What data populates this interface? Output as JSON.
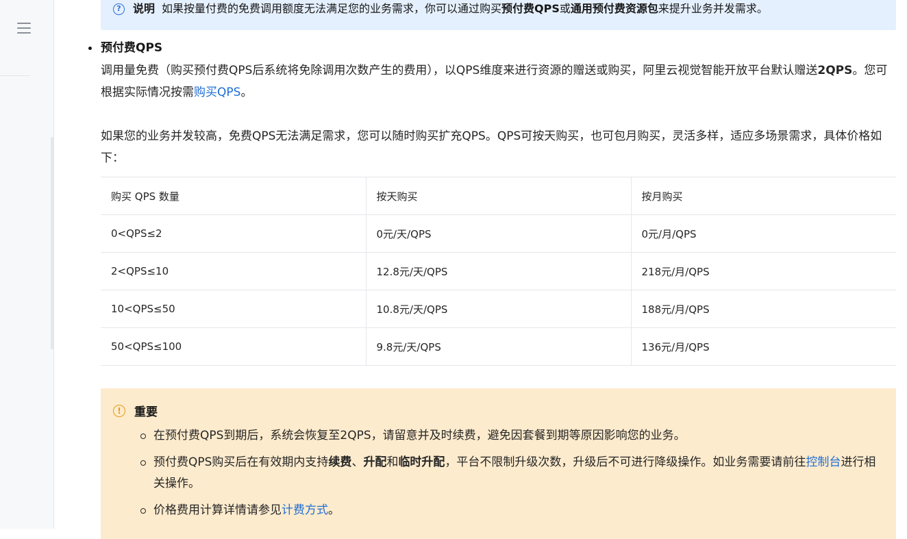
{
  "note": {
    "label": "说明",
    "text_a": "如果按量付费的免费调用额度无法满足您的业务需求，你可以通过购买",
    "bold_a": "预付费QPS",
    "text_b": "或",
    "bold_b": "通用预付费资源包",
    "text_c": "来提升业务并发需求。"
  },
  "section": {
    "heading": "预付费QPS",
    "intro_a": "调用量免费（购买预付费QPS后系统将免除调用次数产生的费用），以QPS维度来进行资源的赠送或购买，阿里云视觉智能开放平台默认赠送",
    "intro_bold": "2QPS",
    "intro_b": "。您可根据实际情况按需",
    "intro_link": "购买QPS",
    "intro_c": "。",
    "para2": "如果您的业务并发较高，免费QPS无法满足需求，您可以随时购买扩充QPS。QPS可按天购买，也可包月购买，灵活多样，适应多场景需求，具体价格如下："
  },
  "table": {
    "headers": [
      "购买 QPS 数量",
      "按天购买",
      "按月购买"
    ],
    "rows": [
      [
        "0<QPS≤2",
        "0元/天/QPS",
        "0元/月/QPS"
      ],
      [
        "2<QPS≤10",
        "12.8元/天/QPS",
        "218元/月/QPS"
      ],
      [
        "10<QPS≤50",
        "10.8元/天/QPS",
        "188元/月/QPS"
      ],
      [
        "50<QPS≤100",
        "9.8元/天/QPS",
        "136元/月/QPS"
      ]
    ]
  },
  "important": {
    "title": "重要",
    "item1": "在预付费QPS到期后，系统会恢复至2QPS，请留意并及时续费，避免因套餐到期等原因影响您的业务。",
    "item2_a": "预付费QPS购买后在有效期内支持",
    "item2_b1": "续费",
    "item2_sep1": "、",
    "item2_b2": "升配",
    "item2_sep2": "和",
    "item2_b3": "临时升配",
    "item2_c": "，平台不限制升级次数，升级后不可进行降级操作。如业务需要请前往",
    "item2_link": "控制台",
    "item2_d": "进行相关操作。",
    "item3_a": "价格费用计算详情请参见",
    "item3_link": "计费方式",
    "item3_b": "。"
  },
  "icons": {
    "menu": "menu-icon",
    "info": "info-icon",
    "warning": "warning-icon"
  },
  "colors": {
    "link": "#1f6ed4",
    "note_bg": "#e5f0fe",
    "warning_bg": "#fdebcd",
    "warning_accent": "#e59b16"
  }
}
